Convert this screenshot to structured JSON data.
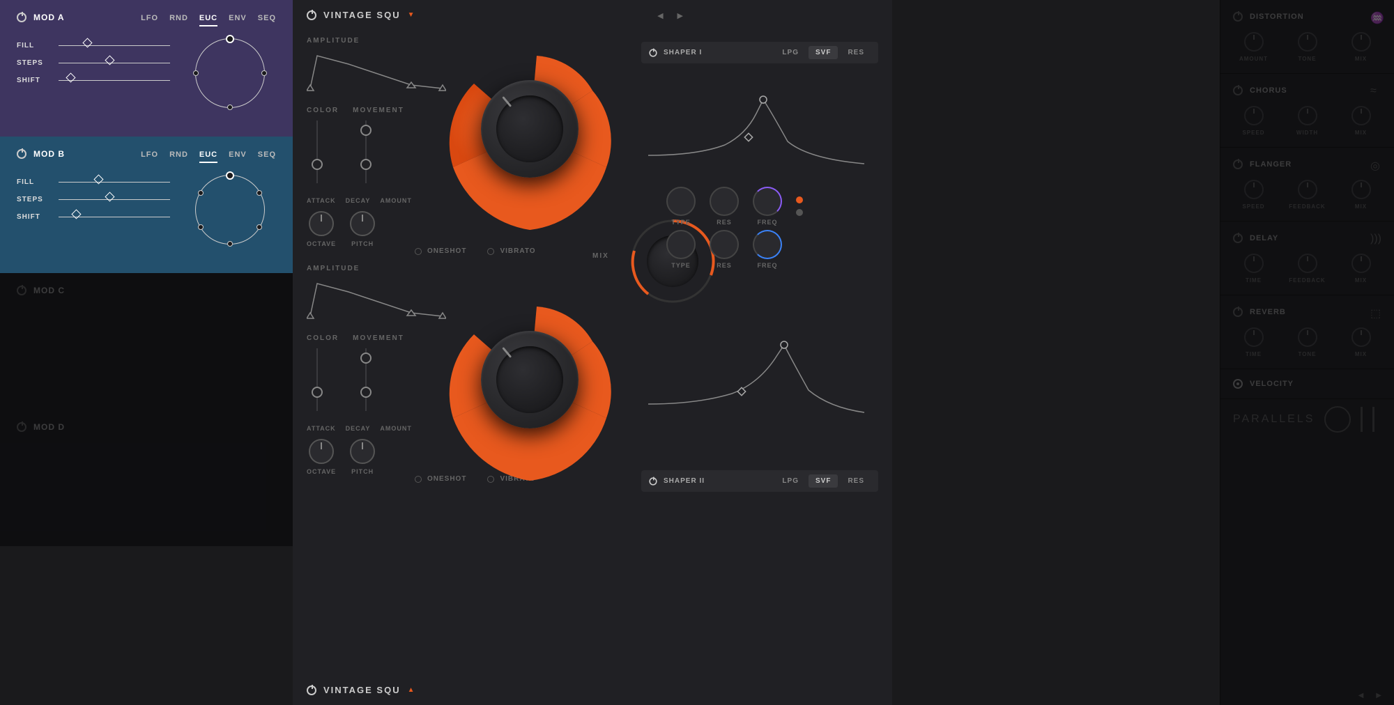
{
  "mods": {
    "a": {
      "title": "MOD A",
      "tabs": [
        "LFO",
        "RND",
        "EUC",
        "ENV",
        "SEQ"
      ],
      "activeTab": "EUC",
      "sliders": {
        "fill": "FILL",
        "steps": "STEPS",
        "shift": "SHIFT"
      }
    },
    "b": {
      "title": "MOD B",
      "tabs": [
        "LFO",
        "RND",
        "EUC",
        "ENV",
        "SEQ"
      ],
      "activeTab": "EUC",
      "sliders": {
        "fill": "FILL",
        "steps": "STEPS",
        "shift": "SHIFT"
      }
    },
    "c": {
      "title": "MOD C"
    },
    "d": {
      "title": "MOD D"
    }
  },
  "source1": {
    "title": "VINTAGE SQU",
    "amplitude_label": "AMPLITUDE",
    "color_label": "COLOR",
    "movement_label": "MOVEMENT",
    "attack_label": "ATTACK",
    "decay_label": "DECAY",
    "amount_label": "AMOUNT",
    "octave_label": "OCTAVE",
    "pitch_label": "PITCH",
    "oneshot_label": "ONESHOT",
    "vibrato_label": "VIBRATO"
  },
  "source2": {
    "title": "VINTAGE SQU",
    "amplitude_label": "AMPLITUDE",
    "color_label": "COLOR",
    "movement_label": "MOVEMENT",
    "attack_label": "ATTACK",
    "decay_label": "DECAY",
    "amount_label": "AMOUNT",
    "octave_label": "OCTAVE",
    "pitch_label": "PITCH",
    "oneshot_label": "ONESHOT",
    "vibrato_label": "VIBRATO"
  },
  "mix_label": "MIX",
  "shaper1": {
    "title": "SHAPER I",
    "tabs": [
      "LPG",
      "SVF",
      "RES"
    ],
    "activeTab": "SVF",
    "row_labels": {
      "type": "TYPE",
      "res": "RES",
      "freq": "FREQ"
    }
  },
  "shaper2": {
    "title": "SHAPER II",
    "tabs": [
      "LPG",
      "SVF",
      "RES"
    ],
    "activeTab": "SVF",
    "row_labels": {
      "type": "TYPE",
      "res": "RES",
      "freq": "FREQ"
    }
  },
  "fx": {
    "distortion": {
      "title": "DISTORTION",
      "knobs": [
        "AMOUNT",
        "TONE",
        "MIX"
      ]
    },
    "chorus": {
      "title": "CHORUS",
      "knobs": [
        "SPEED",
        "WIDTH",
        "MIX"
      ]
    },
    "flanger": {
      "title": "FLANGER",
      "knobs": [
        "SPEED",
        "FEEDBACK",
        "MIX"
      ]
    },
    "delay": {
      "title": "DELAY",
      "knobs": [
        "TIME",
        "FEEDBACK",
        "MIX"
      ]
    },
    "reverb": {
      "title": "REVERB",
      "knobs": [
        "TIME",
        "TONE",
        "MIX"
      ]
    }
  },
  "velocity_label": "VELOCITY",
  "brand": "PARALLELS",
  "colors": {
    "accent": "#e8591e",
    "purple": "#8b5cf6",
    "blue": "#3b82f6"
  }
}
